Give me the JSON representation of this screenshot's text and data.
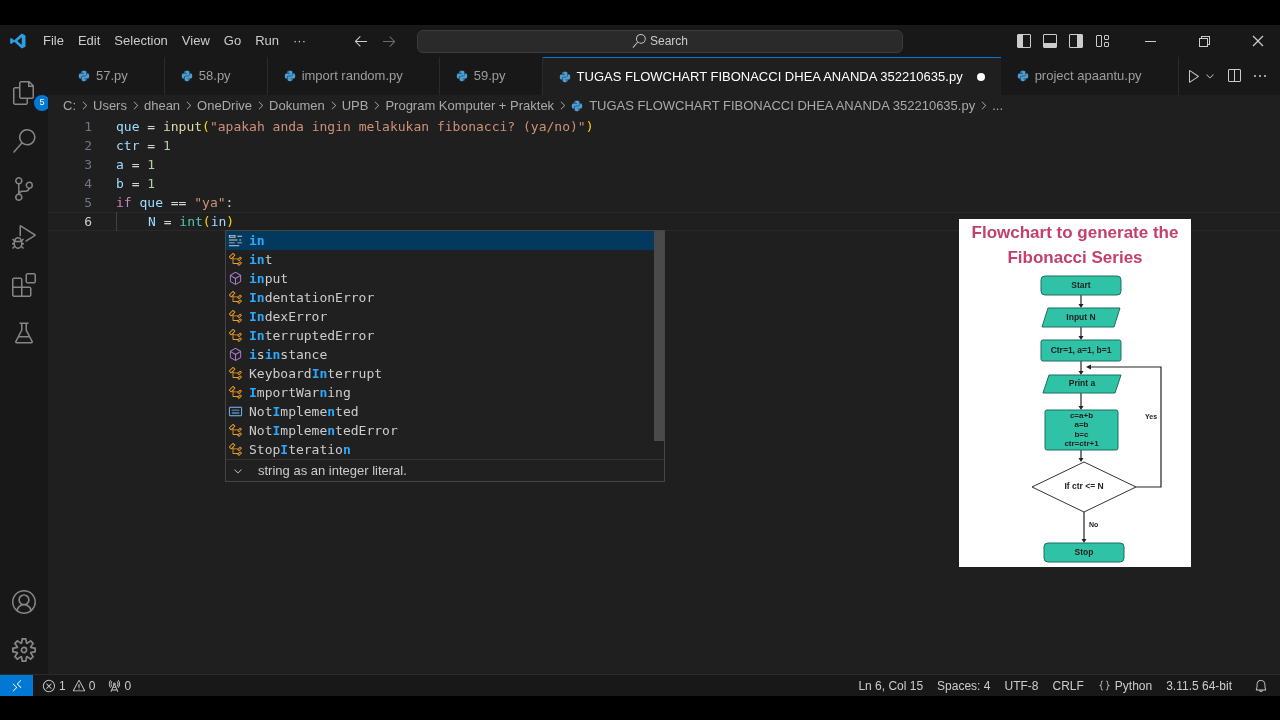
{
  "menu": [
    "File",
    "Edit",
    "Selection",
    "View",
    "Go",
    "Run",
    "···"
  ],
  "search": {
    "placeholder": "Search"
  },
  "activity_badge": "5",
  "tabs": [
    {
      "label": "57.py",
      "selected": false,
      "modified": false
    },
    {
      "label": "58.py",
      "selected": false,
      "modified": false
    },
    {
      "label": "import random.py",
      "selected": false,
      "modified": false
    },
    {
      "label": "59.py",
      "selected": false,
      "modified": false
    },
    {
      "label": "TUGAS FLOWCHART FIBONACCI DHEA ANANDA 352210635.py",
      "selected": true,
      "modified": true
    },
    {
      "label": "project apaantu.py",
      "selected": false,
      "modified": false
    }
  ],
  "breadcrumbs": [
    {
      "label": "C:",
      "kind": "folder"
    },
    {
      "label": "Users",
      "kind": "folder"
    },
    {
      "label": "dhean",
      "kind": "folder"
    },
    {
      "label": "OneDrive",
      "kind": "folder"
    },
    {
      "label": "Dokumen",
      "kind": "folder"
    },
    {
      "label": "UPB",
      "kind": "folder"
    },
    {
      "label": "Program Komputer + Praktek",
      "kind": "folder"
    },
    {
      "label": "TUGAS FLOWCHART FIBONACCI DHEA ANANDA 352210635.py",
      "kind": "file"
    },
    {
      "label": "...",
      "kind": "symbol"
    }
  ],
  "code_lines": [
    {
      "number": "1",
      "current": false,
      "indented": false,
      "tokens": [
        {
          "text": "que",
          "kind": "var"
        },
        {
          "text": " = ",
          "kind": "op"
        },
        {
          "text": "input",
          "kind": "fn"
        },
        {
          "text": "(",
          "kind": "bracket"
        },
        {
          "text": "\"apakah anda ingin melakukan fibonacci? (ya/no)\"",
          "kind": "str"
        },
        {
          "text": ")",
          "kind": "bracket"
        }
      ]
    },
    {
      "number": "2",
      "current": false,
      "indented": false,
      "tokens": [
        {
          "text": "ctr",
          "kind": "var"
        },
        {
          "text": " = ",
          "kind": "op"
        },
        {
          "text": "1",
          "kind": "num"
        }
      ]
    },
    {
      "number": "3",
      "current": false,
      "indented": false,
      "tokens": [
        {
          "text": "a",
          "kind": "var"
        },
        {
          "text": " = ",
          "kind": "op"
        },
        {
          "text": "1",
          "kind": "num"
        }
      ]
    },
    {
      "number": "4",
      "current": false,
      "indented": false,
      "tokens": [
        {
          "text": "b",
          "kind": "var"
        },
        {
          "text": " = ",
          "kind": "op"
        },
        {
          "text": "1",
          "kind": "num"
        }
      ]
    },
    {
      "number": "5",
      "current": false,
      "indented": false,
      "tokens": [
        {
          "text": "if ",
          "kind": "kw"
        },
        {
          "text": "que",
          "kind": "var"
        },
        {
          "text": " == ",
          "kind": "op"
        },
        {
          "text": "\"ya\"",
          "kind": "str"
        },
        {
          "text": ":",
          "kind": "op"
        }
      ]
    },
    {
      "number": "6",
      "current": true,
      "indented": true,
      "tokens": [
        {
          "text": "N",
          "kind": "var"
        },
        {
          "text": " = ",
          "kind": "op"
        },
        {
          "text": "int",
          "kind": "cls"
        },
        {
          "text": "(",
          "kind": "bracket"
        },
        {
          "text": "in",
          "kind": "var"
        },
        {
          "text": ")",
          "kind": "bracket"
        }
      ]
    }
  ],
  "suggestions": [
    {
      "kind": "keyword",
      "selected": true,
      "segments": [
        {
          "text": "in",
          "match": true
        }
      ]
    },
    {
      "kind": "class",
      "selected": false,
      "segments": [
        {
          "text": "in",
          "match": true
        },
        {
          "text": "t",
          "match": false
        }
      ]
    },
    {
      "kind": "function",
      "selected": false,
      "segments": [
        {
          "text": "in",
          "match": true
        },
        {
          "text": "put",
          "match": false
        }
      ]
    },
    {
      "kind": "class",
      "selected": false,
      "segments": [
        {
          "text": "In",
          "match": true
        },
        {
          "text": "dentationError",
          "match": false
        }
      ]
    },
    {
      "kind": "class",
      "selected": false,
      "segments": [
        {
          "text": "In",
          "match": true
        },
        {
          "text": "dexError",
          "match": false
        }
      ]
    },
    {
      "kind": "class",
      "selected": false,
      "segments": [
        {
          "text": "In",
          "match": true
        },
        {
          "text": "terruptedError",
          "match": false
        }
      ]
    },
    {
      "kind": "function",
      "selected": false,
      "segments": [
        {
          "text": "i",
          "match": true
        },
        {
          "text": "s",
          "match": false
        },
        {
          "text": "in",
          "match": true
        },
        {
          "text": "stance",
          "match": false
        }
      ]
    },
    {
      "kind": "class",
      "selected": false,
      "segments": [
        {
          "text": "Keyboard",
          "match": false
        },
        {
          "text": "In",
          "match": true
        },
        {
          "text": "terrupt",
          "match": false
        }
      ]
    },
    {
      "kind": "class",
      "selected": false,
      "segments": [
        {
          "text": "I",
          "match": true
        },
        {
          "text": "mportWar",
          "match": false
        },
        {
          "text": "n",
          "match": true
        },
        {
          "text": "ing",
          "match": false
        }
      ]
    },
    {
      "kind": "constant",
      "selected": false,
      "segments": [
        {
          "text": "Not",
          "match": false
        },
        {
          "text": "I",
          "match": true
        },
        {
          "text": "mpleme",
          "match": false
        },
        {
          "text": "n",
          "match": true
        },
        {
          "text": "ted",
          "match": false
        }
      ]
    },
    {
      "kind": "class",
      "selected": false,
      "segments": [
        {
          "text": "Not",
          "match": false
        },
        {
          "text": "I",
          "match": true
        },
        {
          "text": "mpleme",
          "match": false
        },
        {
          "text": "n",
          "match": true
        },
        {
          "text": "tedError",
          "match": false
        }
      ]
    },
    {
      "kind": "class",
      "selected": false,
      "segments": [
        {
          "text": "Stop",
          "match": false
        },
        {
          "text": "I",
          "match": true
        },
        {
          "text": "teratio",
          "match": false
        },
        {
          "text": "n",
          "match": true
        }
      ]
    }
  ],
  "suggestion_detail": "string as an integer literal.",
  "flowchart": {
    "title": "Flowchart to generate the Fibonacci Series",
    "nodes": [
      {
        "kind": "terminal",
        "lines": [
          "Start"
        ]
      },
      {
        "kind": "io",
        "lines": [
          "Input N"
        ]
      },
      {
        "kind": "process",
        "lines": [
          "Ctr=1, a=1, b=1"
        ]
      },
      {
        "kind": "io",
        "lines": [
          "Print a"
        ]
      },
      {
        "kind": "process",
        "lines": [
          "c=a+b",
          "a=b",
          "b=c",
          "ctr=ctr+1"
        ]
      },
      {
        "kind": "decision",
        "lines": [
          "If ctr <= N"
        ]
      },
      {
        "kind": "terminal",
        "lines": [
          "Stop"
        ]
      }
    ],
    "edge_labels": [
      "Yes",
      "No"
    ]
  },
  "status_bar": {
    "errors": "1",
    "warnings": "0",
    "ports": "0",
    "items": [
      {
        "label": "Ln 6, Col 15",
        "kind": "plain"
      },
      {
        "label": "Spaces: 4",
        "kind": "plain"
      },
      {
        "label": "UTF-8",
        "kind": "plain"
      },
      {
        "label": "CRLF",
        "kind": "plain"
      },
      {
        "label": "Python",
        "kind": "language"
      },
      {
        "label": "3.11.5 64-bit",
        "kind": "plain"
      }
    ]
  }
}
